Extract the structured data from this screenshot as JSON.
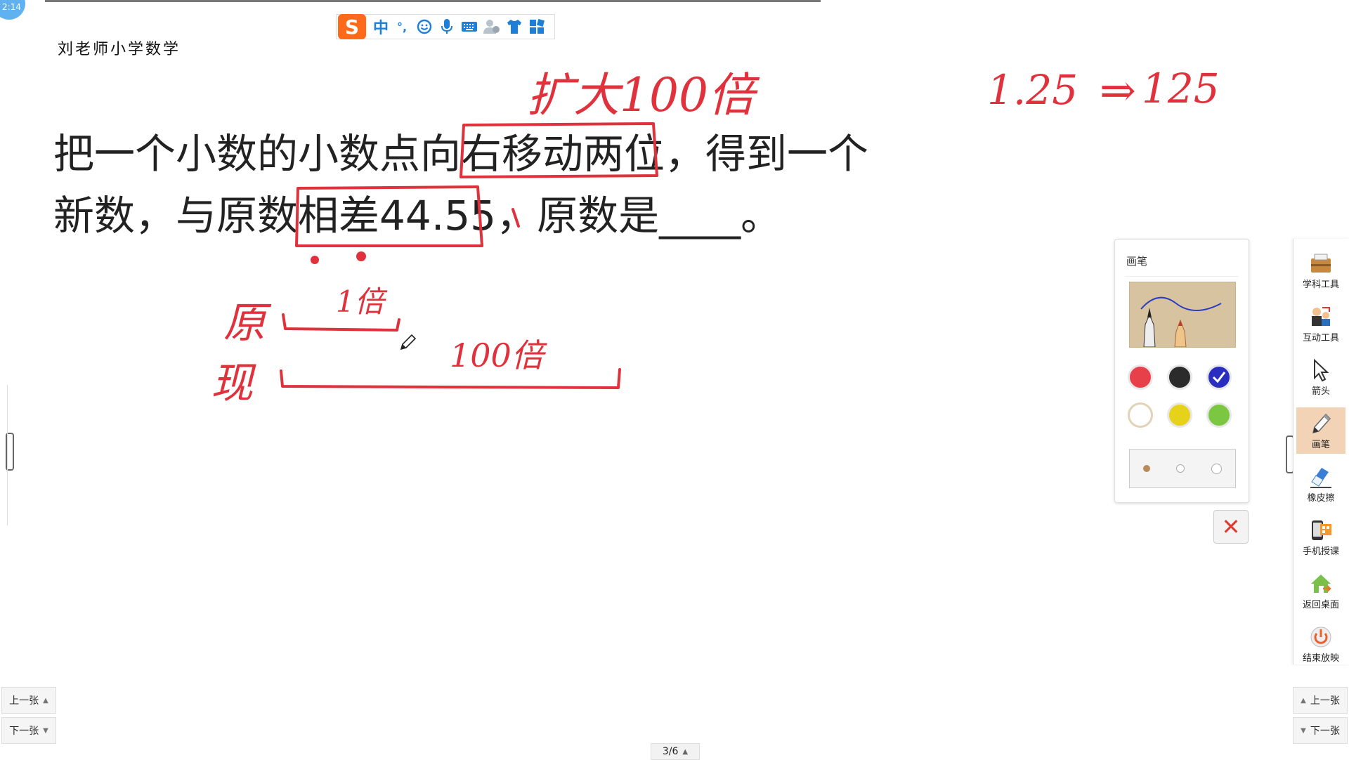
{
  "status": {
    "clock": "2:14"
  },
  "ime": {
    "mode": "中",
    "punct": "°,"
  },
  "slide": {
    "header": "刘老师小学数学",
    "problem_line1_a": "把一个小数的小数点向",
    "problem_line1_b": "右移动两位",
    "problem_line1_c": "，得到一个",
    "problem_line2_a": "新数，与原数",
    "problem_line2_b": "相差44.55",
    "problem_line2_c": "，原数是____。"
  },
  "annotations": {
    "top": "扩大100倍",
    "equation_left": "1.25",
    "equation_arrow": "⇒",
    "equation_right": "125",
    "orig_label": "原",
    "now_label": "现",
    "one_times": "1倍",
    "hundred_times": "100倍"
  },
  "pen_panel": {
    "title": "画笔",
    "colors": [
      "#e8404a",
      "#2b2b2b",
      "#2a2ec0",
      "#ffffff",
      "#e6d21a",
      "#7cc742"
    ],
    "selected_color_index": 2
  },
  "toolbar": {
    "items": [
      {
        "label": "学科工具",
        "icon": "subject-tools-icon"
      },
      {
        "label": "互动工具",
        "icon": "interactive-tools-icon"
      },
      {
        "label": "箭头",
        "icon": "arrow-cursor-icon"
      },
      {
        "label": "画笔",
        "icon": "pen-icon"
      },
      {
        "label": "橡皮擦",
        "icon": "eraser-icon"
      },
      {
        "label": "手机授课",
        "icon": "phone-teaching-icon"
      },
      {
        "label": "返回桌面",
        "icon": "home-icon"
      },
      {
        "label": "结束放映",
        "icon": "power-icon"
      }
    ],
    "active_index": 3
  },
  "nav": {
    "left_prev": "上一张",
    "left_next": "下一张",
    "right_prev": "上一张",
    "right_next": "下一张",
    "page": "3/6"
  }
}
